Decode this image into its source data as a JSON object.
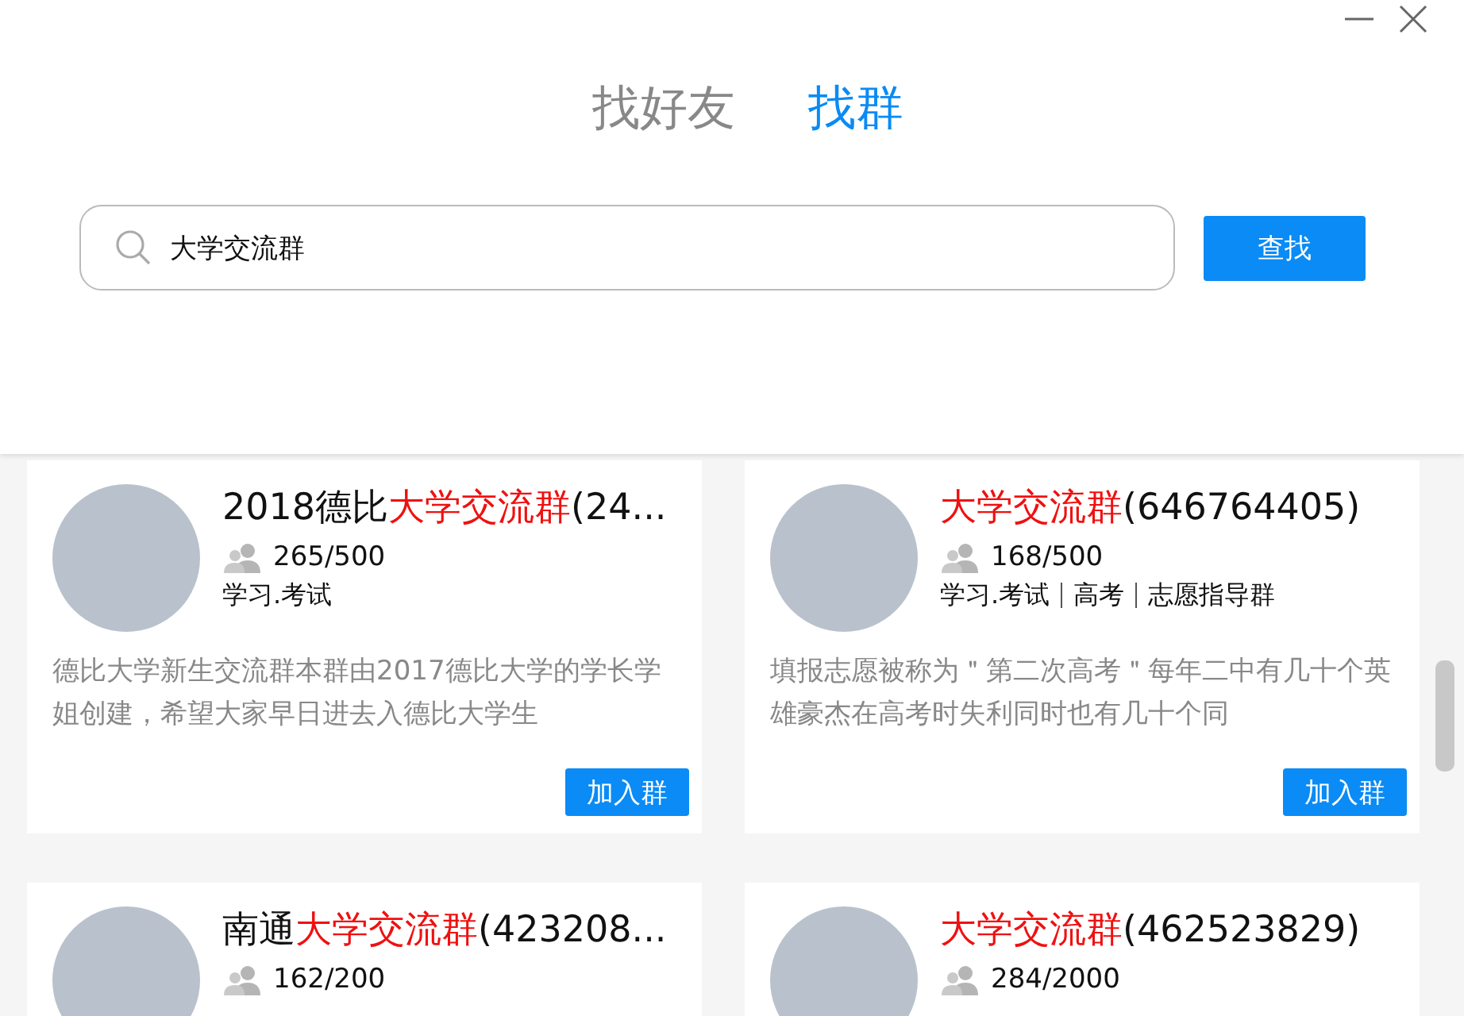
{
  "tabs": [
    {
      "label": "找好友",
      "selected": false
    },
    {
      "label": "找群",
      "selected": true
    }
  ],
  "search": {
    "value": "大学交流群",
    "button": "查找"
  },
  "groups": [
    {
      "title": [
        {
          "text": "2018德比",
          "highlight": false
        },
        {
          "text": "大学交流群",
          "highlight": true
        },
        {
          "text": "(24...",
          "highlight": false
        }
      ],
      "members": "265/500",
      "tags": [
        "学习.考试"
      ],
      "description": "德比大学新生交流群本群由2017德比大学的学长学姐创建，希望大家早日进去入德比大学生",
      "join": "加入群"
    },
    {
      "title": [
        {
          "text": "大学交流群",
          "highlight": true
        },
        {
          "text": "(646764405)",
          "highlight": false
        }
      ],
      "members": "168/500",
      "tags": [
        "学习.考试",
        "高考",
        "志愿指导群"
      ],
      "description": "填报志愿被称为＂第二次高考＂每年二中有几十个英雄豪杰在高考时失利同时也有几十个同",
      "join": "加入群"
    },
    {
      "title": [
        {
          "text": "南通",
          "highlight": false
        },
        {
          "text": "大学交流群",
          "highlight": true
        },
        {
          "text": "(423208...",
          "highlight": false
        }
      ],
      "members": "162/200"
    },
    {
      "title": [
        {
          "text": "大学交流群",
          "highlight": true
        },
        {
          "text": "(462523829)",
          "highlight": false
        }
      ],
      "members": "284/2000"
    }
  ]
}
